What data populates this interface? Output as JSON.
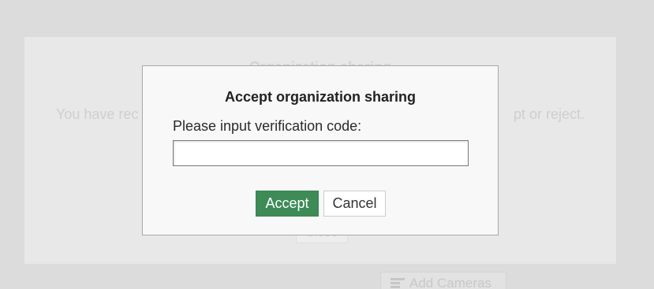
{
  "background_dialog": {
    "title": "Organization sharing",
    "message_left": "You have rec",
    "message_right": "pt or reject.",
    "close_label": "Close",
    "add_cameras_label": "Add Cameras",
    "add_cameras_icon": "list-add-icon"
  },
  "modal": {
    "title": "Accept organization sharing",
    "label": "Please input verification code:",
    "input_value": "",
    "input_placeholder": "",
    "accept_label": "Accept",
    "cancel_label": "Cancel"
  },
  "colors": {
    "accept_bg": "#3e8b57",
    "overlay_bg": "#dcdcdc"
  }
}
